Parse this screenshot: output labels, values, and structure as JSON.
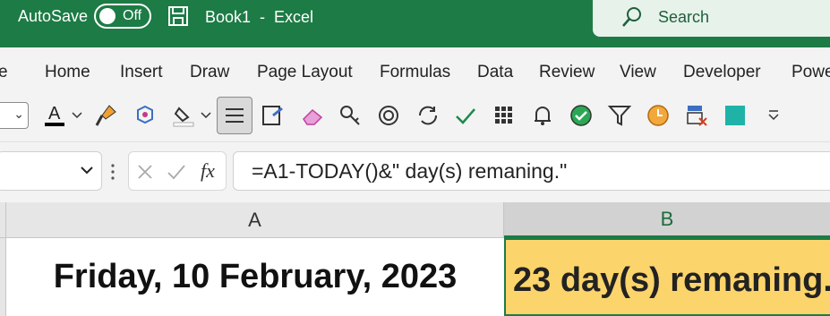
{
  "titlebar": {
    "autosave_label": "AutoSave",
    "autosave_state": "Off",
    "document_name": "Book1  -  Excel",
    "search_label": "Search"
  },
  "ribbon": {
    "tabs": [
      "e",
      "Home",
      "Insert",
      "Draw",
      "Page Layout",
      "Formulas",
      "Data",
      "Review",
      "View",
      "Developer",
      "Powe"
    ]
  },
  "toolbar": {
    "icons": [
      "font-color-icon",
      "format-painter-icon",
      "paste-special-icon",
      "fill-color-icon",
      "align-center-icon",
      "format-icon",
      "eraser-icon",
      "key-icon",
      "target-icon",
      "refresh-icon",
      "checkmark-icon",
      "grid-icon",
      "bell-icon",
      "check-circle-icon",
      "filter-icon",
      "clock-icon",
      "clear-format-icon",
      "cell-color-icon",
      "more-icon"
    ]
  },
  "formula_bar": {
    "fx_label": "fx",
    "formula": "=A1-TODAY()&\" day(s) remaning.\""
  },
  "grid": {
    "columns": [
      "A",
      "B"
    ],
    "cell_a1": "Friday, 10 February, 2023",
    "cell_b1": "23 day(s) remaning."
  },
  "colors": {
    "excel_green": "#1d7b45",
    "cell_b1_fill": "#fbd46b"
  }
}
